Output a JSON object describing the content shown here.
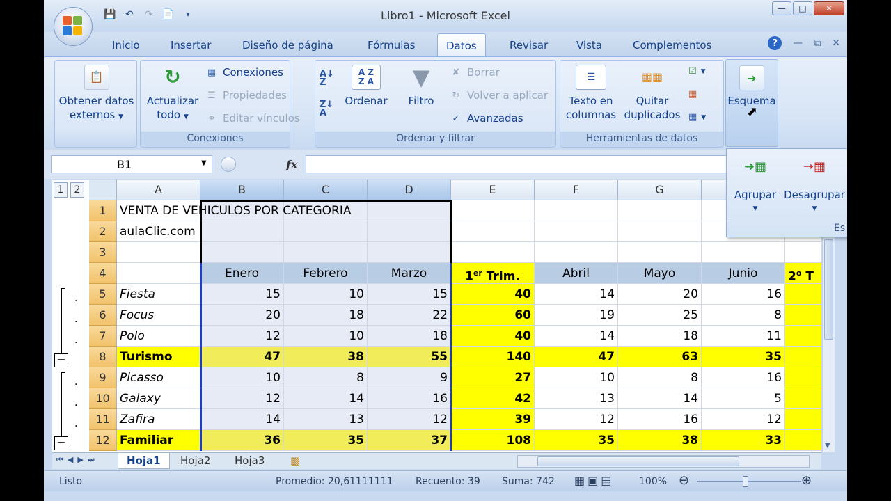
{
  "window": {
    "title": "Libro1 - Microsoft Excel"
  },
  "tabs": [
    "Inicio",
    "Insertar",
    "Diseño de página",
    "Fórmulas",
    "Datos",
    "Revisar",
    "Vista",
    "Complementos"
  ],
  "ribbon": {
    "obtener": "Obtener datos",
    "externos": "externos",
    "actualizar": "Actualizar",
    "todo": "todo",
    "conexiones_btn": "Conexiones",
    "propiedades": "Propiedades",
    "editar_vinculos": "Editar vínculos",
    "group_conexiones": "Conexiones",
    "ordenar": "Ordenar",
    "filtro": "Filtro",
    "borrar": "Borrar",
    "volver_aplicar": "Volver a aplicar",
    "avanzadas": "Avanzadas",
    "group_ordenar": "Ordenar y filtrar",
    "texto_en": "Texto en",
    "columnas": "columnas",
    "quitar": "Quitar",
    "duplicados": "duplicados",
    "group_herramientas": "Herramientas de datos",
    "esquema": "Esquema",
    "agrupar": "Agrupar",
    "desagrupar": "Desagrupar",
    "es": "Es"
  },
  "formula_bar": {
    "cell_ref": "B1",
    "fx": "fx"
  },
  "outline_levels": [
    "1",
    "2"
  ],
  "columns": [
    "A",
    "B",
    "C",
    "D",
    "E",
    "F",
    "G"
  ],
  "rows": [
    {
      "n": "1",
      "a": "VENTA DE VEHICULOS POR CATEGORIA"
    },
    {
      "n": "2",
      "a": "aulaClic.com"
    },
    {
      "n": "3",
      "a": ""
    },
    {
      "n": "4",
      "a": "",
      "b": "Enero",
      "c": "Febrero",
      "d": "Marzo",
      "e1": "1",
      "e_sup": "er",
      "e2": " Trim.",
      "f": "Abril",
      "g": "Mayo",
      "h": "Junio",
      "i1": "2",
      "i_sup": "o",
      "i2": " T"
    },
    {
      "n": "5",
      "a": "Fiesta",
      "b": "15",
      "c": "10",
      "d": "15",
      "e": "40",
      "f": "14",
      "g": "20",
      "h": "16"
    },
    {
      "n": "6",
      "a": "Focus",
      "b": "20",
      "c": "18",
      "d": "22",
      "e": "60",
      "f": "19",
      "g": "25",
      "h": "8"
    },
    {
      "n": "7",
      "a": "Polo",
      "b": "12",
      "c": "10",
      "d": "18",
      "e": "40",
      "f": "14",
      "g": "18",
      "h": "11"
    },
    {
      "n": "8",
      "a": "Turismo",
      "b": "47",
      "c": "38",
      "d": "55",
      "e": "140",
      "f": "47",
      "g": "63",
      "h": "35"
    },
    {
      "n": "9",
      "a": "Picasso",
      "b": "10",
      "c": "8",
      "d": "9",
      "e": "27",
      "f": "10",
      "g": "8",
      "h": "16"
    },
    {
      "n": "10",
      "a": "Galaxy",
      "b": "12",
      "c": "14",
      "d": "16",
      "e": "42",
      "f": "13",
      "g": "14",
      "h": "5"
    },
    {
      "n": "11",
      "a": "Zafira",
      "b": "14",
      "c": "13",
      "d": "12",
      "e": "39",
      "f": "12",
      "g": "16",
      "h": "12"
    },
    {
      "n": "12",
      "a": "Familiar",
      "b": "36",
      "c": "35",
      "d": "37",
      "e": "108",
      "f": "35",
      "g": "38",
      "h": "33"
    }
  ],
  "sheets": [
    "Hoja1",
    "Hoja2",
    "Hoja3"
  ],
  "status": {
    "ready": "Listo",
    "promedio": "Promedio: 20,61111111",
    "recuento": "Recuento: 39",
    "suma": "Suma: 742",
    "zoom": "100%"
  },
  "colors": {
    "yellow": "#ffff00",
    "header_blue": "#b8cce4",
    "selection": "#e6ebf5"
  }
}
